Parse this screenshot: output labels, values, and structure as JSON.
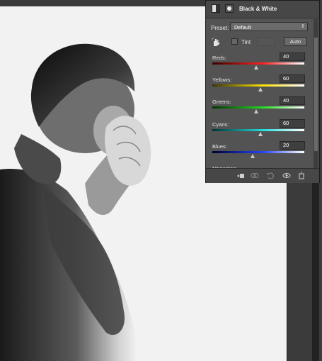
{
  "panel": {
    "title": "Black & White",
    "preset_label": "Preset:",
    "preset_value": "Default",
    "tint_label": "Tint",
    "auto_label": "Auto",
    "tint_checked": false
  },
  "sliders": [
    {
      "label": "Reds:",
      "value": "40",
      "level": 40
    },
    {
      "label": "Yellows:",
      "value": "60",
      "level": 60
    },
    {
      "label": "Greens:",
      "value": "40",
      "level": 40
    },
    {
      "label": "Cyans:",
      "value": "60",
      "level": 60
    },
    {
      "label": "Blues:",
      "value": "20",
      "level": 20
    },
    {
      "label": "Magentas:",
      "value": "",
      "level": null
    }
  ],
  "slider_range": [
    -200,
    300
  ],
  "slider_colors": {
    "Reds": [
      "#3a0000",
      "#ff2020",
      "#ffffff"
    ],
    "Yellows": [
      "#3a3300",
      "#ffe400",
      "#ffffff"
    ],
    "Greens": [
      "#003300",
      "#22dd22",
      "#ffffff"
    ],
    "Cyans": [
      "#003333",
      "#22dddd",
      "#ffffff"
    ],
    "Blues": [
      "#000033",
      "#2244ff",
      "#ffffff"
    ],
    "Magentas": [
      "#330033",
      "#ee22ee",
      "#ffffff"
    ]
  },
  "icons": {
    "hand_tool": "targeted-adjustment-hand-icon",
    "footer": [
      "clip-to-layer-icon",
      "view-previous-icon",
      "reset-icon",
      "visibility-eye-icon",
      "trash-icon"
    ]
  }
}
